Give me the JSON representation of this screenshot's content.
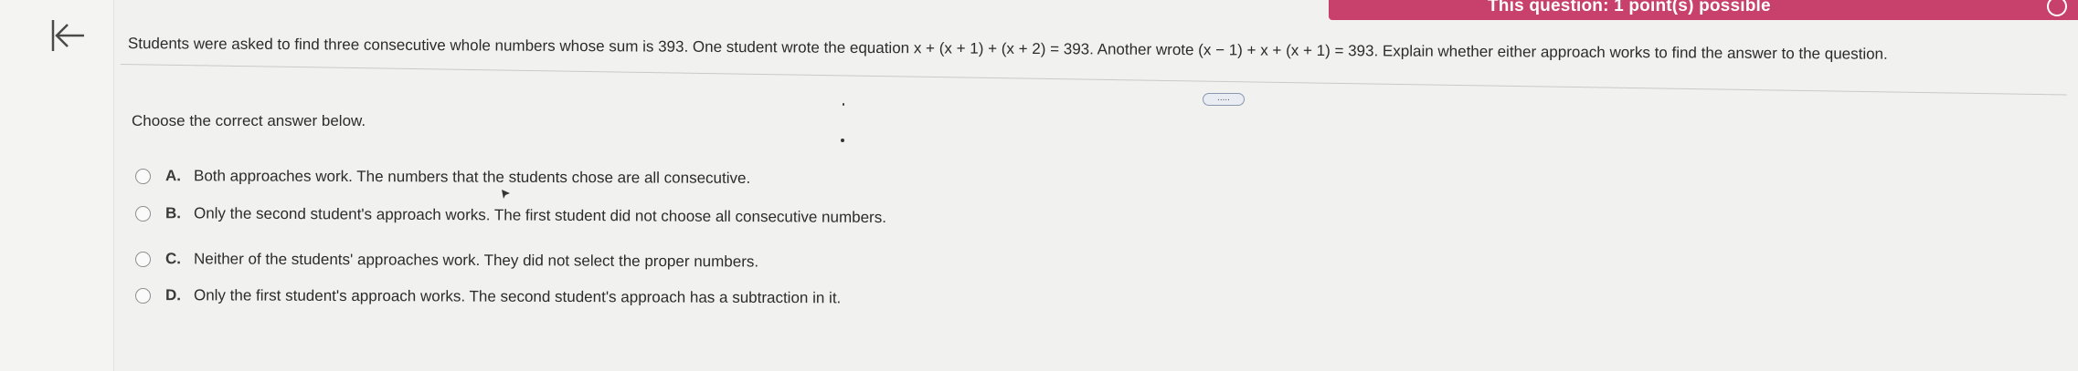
{
  "banner": {
    "points_text": "This question: 1 point(s) possible",
    "background_color": "#c8406c",
    "icon": "settings-gear-icon"
  },
  "navigation": {
    "back_icon": "collapse-left-arrow-icon"
  },
  "question": {
    "text": "Students were asked to find three consecutive whole numbers whose sum is 393. One student wrote the equation x + (x + 1) + (x + 2) = 393. Another wrote (x − 1) + x + (x + 1) = 393. Explain whether either approach works to find the answer to the question.",
    "more_label": "....."
  },
  "prompt": "Choose the correct answer below.",
  "options": [
    {
      "letter": "A.",
      "text": "Both approaches work. The numbers that the students chose are all consecutive."
    },
    {
      "letter": "B.",
      "text": "Only the second student's approach works. The first student did not choose all consecutive numbers."
    },
    {
      "letter": "C.",
      "text": "Neither of the students' approaches work. They did not select the proper numbers."
    },
    {
      "letter": "D.",
      "text": "Only the first student's approach works. The second student's approach has a subtraction in it."
    }
  ]
}
